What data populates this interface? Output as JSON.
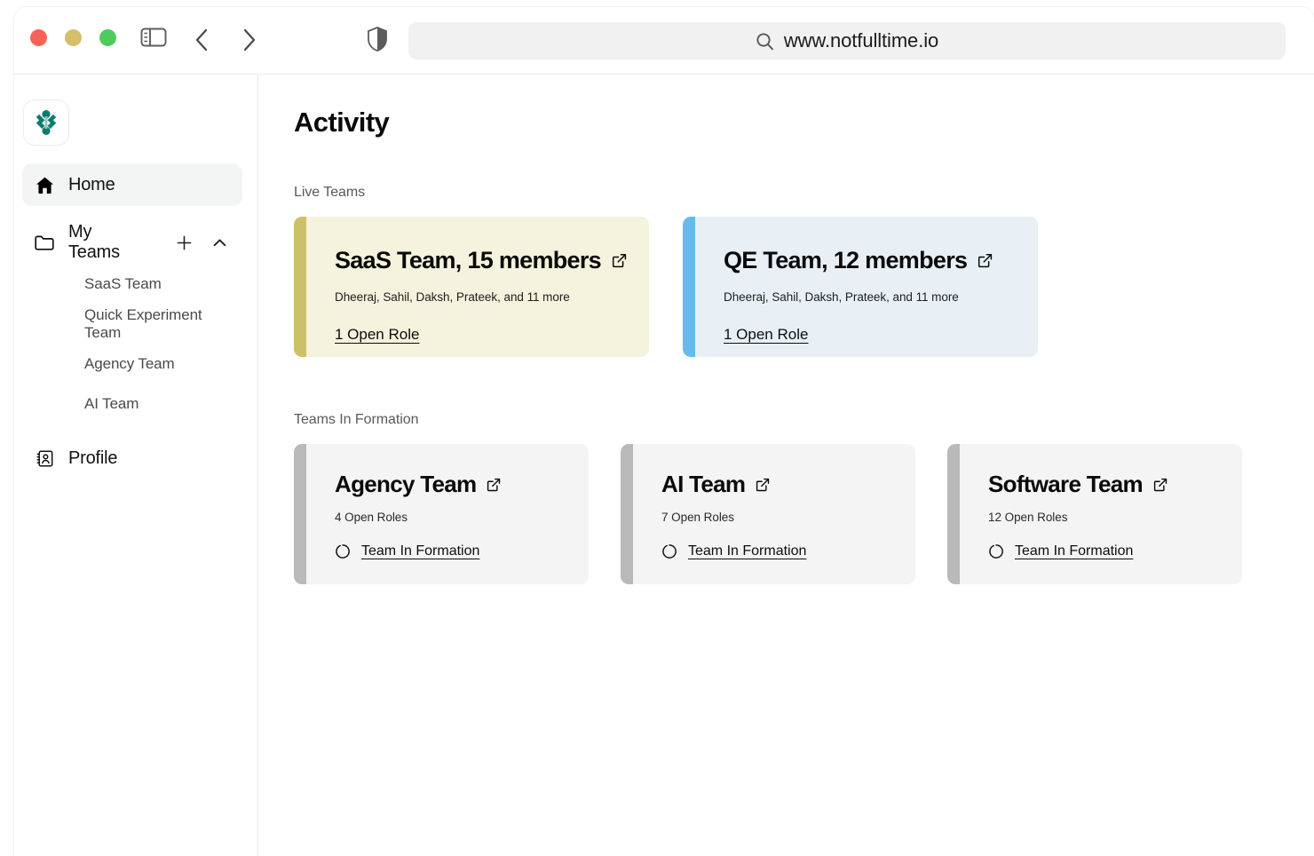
{
  "browser": {
    "traffic_lights": [
      "close",
      "minimize",
      "maximize"
    ],
    "sidebar_toggle_icon": "sidebar-toggle-icon",
    "back_icon": "chevron-left-icon",
    "forward_icon": "chevron-right-icon",
    "shield_icon": "shield-icon",
    "search_icon": "search-icon",
    "url": "www.notfulltime.io"
  },
  "sidebar": {
    "logo_icon": "brand-logo-icon",
    "home": {
      "label": "Home",
      "icon": "home-icon"
    },
    "my_teams": {
      "label": "My Teams",
      "icon": "folder-icon",
      "add_icon": "plus-icon",
      "collapse_icon": "chevron-up-icon",
      "items": [
        {
          "label": "SaaS Team"
        },
        {
          "label": "Quick Experiment Team"
        },
        {
          "label": "Agency Team"
        },
        {
          "label": "AI Team"
        }
      ]
    },
    "profile": {
      "label": "Profile",
      "icon": "contact-card-icon"
    }
  },
  "main": {
    "title": "Activity",
    "sections": [
      {
        "label": "Live Teams",
        "cards": [
          {
            "title": "SaaS Team, 15 members",
            "members": "Dheeraj, Sahil, Daksh, Prateek, and 11 more",
            "link": "1 Open Role",
            "external_icon": "external-link-icon",
            "accent_color": "#ccc168",
            "bg_color": "#f5f3dd",
            "variant": "gold"
          },
          {
            "title": "QE Team, 12 members",
            "members": "Dheeraj, Sahil, Daksh, Prateek, and 11 more",
            "link": "1 Open Role",
            "external_icon": "external-link-icon",
            "accent_color": "#65bcec",
            "bg_color": "#e9f0f5",
            "variant": "blue"
          }
        ]
      },
      {
        "label": "Teams In Formation",
        "cards": [
          {
            "title": "Agency Team",
            "roles": "4 Open Roles",
            "link": "Team In Formation",
            "external_icon": "external-link-icon",
            "status_icon": "spinner-icon",
            "accent_color": "#b9b9b9",
            "bg_color": "#f4f4f4"
          },
          {
            "title": "AI Team",
            "roles": "7 Open Roles",
            "link": "Team In Formation",
            "external_icon": "external-link-icon",
            "status_icon": "spinner-icon",
            "accent_color": "#b9b9b9",
            "bg_color": "#f4f4f4"
          },
          {
            "title": "Software Team",
            "roles": "12 Open Roles",
            "link": "Team In Formation",
            "external_icon": "external-link-icon",
            "status_icon": "spinner-icon",
            "accent_color": "#b9b9b9",
            "bg_color": "#f4f4f4"
          }
        ]
      }
    ]
  }
}
